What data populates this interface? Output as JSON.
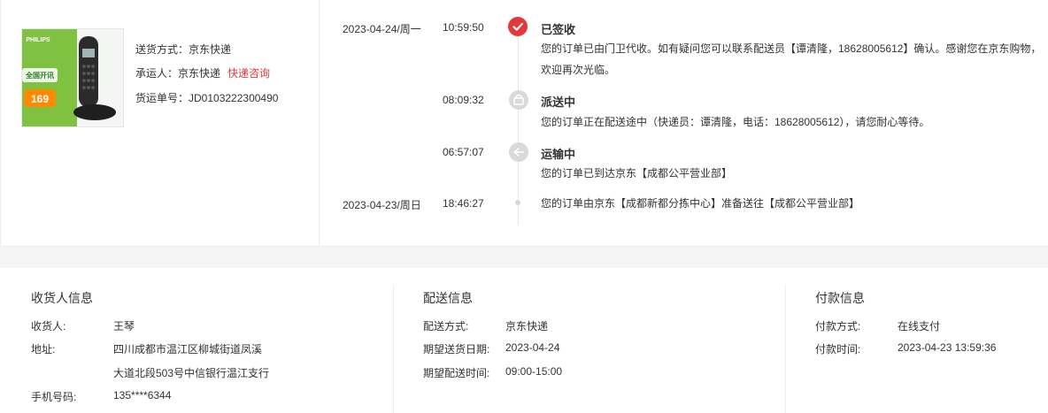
{
  "shipping": {
    "method_label": "送货方式：",
    "method_value": "京东快递",
    "carrier_label": "承运人：",
    "carrier_value": "京东快递",
    "carrier_link": "快递咨询",
    "waybill_label": "货运单号：",
    "waybill_value": "JD0103222300490",
    "product_brand": "PHILIPS",
    "product_badge_text": "全国开讯",
    "product_price": "169"
  },
  "timeline": [
    {
      "date": "2023-04-24/周一",
      "time": "10:59:50",
      "title": "已签收",
      "desc": "您的订单已由门卫代收。如有疑问您可以联系配送员【谭清隆，18628005612】确认。感谢您在京东购物，欢迎再次光临。",
      "icon": "check-icon",
      "color": "#e4393c"
    },
    {
      "date": "",
      "time": "08:09:32",
      "title": "派送中",
      "desc": "您的订单正在配送途中（快递员：谭清隆，电话：18628005612），请您耐心等待。",
      "icon": "delivery-icon",
      "color": "#d9d9d9"
    },
    {
      "date": "",
      "time": "06:57:07",
      "title": "运输中",
      "desc": "您的订单已到达京东【成都公平营业部】",
      "icon": "transport-icon",
      "color": "#d9d9d9"
    },
    {
      "date": "2023-04-23/周日",
      "time": "18:46:27",
      "title": "",
      "desc": "您的订单由京东【成都新都分拣中心】准备送往【成都公平营业部】",
      "icon": "dot-icon",
      "color": "#d9d9d9"
    }
  ],
  "receiver": {
    "title": "收货人信息",
    "name_label": "收货人:",
    "name_value": "王琴",
    "address_label": "地址:",
    "address_line1": "四川成都市温江区柳城街道凤溪",
    "address_line2": "大道北段503号中信银行温江支行",
    "phone_label": "手机号码:",
    "phone_value": "135****6344"
  },
  "delivery": {
    "title": "配送信息",
    "method_label": "配送方式:",
    "method_value": "京东快递",
    "date_label": "期望送货日期:",
    "date_value": "2023-04-24",
    "time_label": "期望配送时间:",
    "time_value": "09:00-15:00"
  },
  "payment": {
    "title": "付款信息",
    "method_label": "付款方式:",
    "method_value": "在线支付",
    "time_label": "付款时间:",
    "time_value": "2023-04-23 13:59:36"
  }
}
